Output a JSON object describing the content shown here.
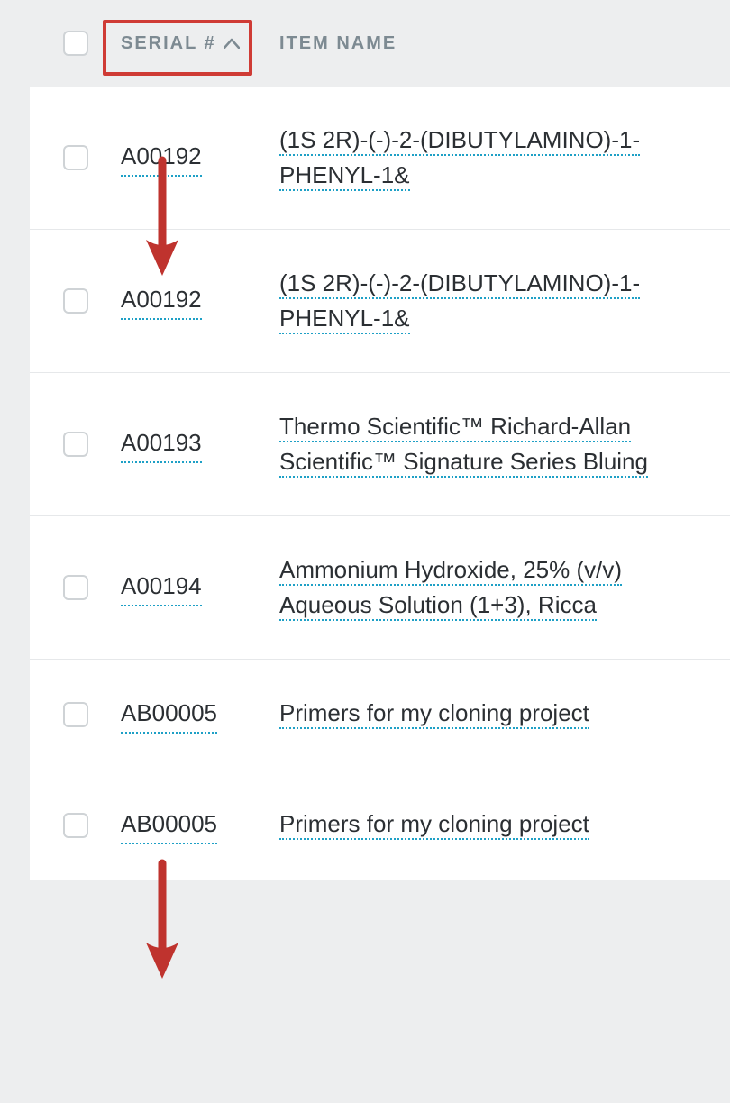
{
  "columns": {
    "serial": "SERIAL #",
    "name": "ITEM NAME"
  },
  "rows": [
    {
      "serial": "A00192",
      "name": "(1S 2R)-(-)-2-(DIBUTYLAMINO)-1-PHENYL-1&"
    },
    {
      "serial": "A00192",
      "name": "(1S 2R)-(-)-2-(DIBUTYLAMINO)-1-PHENYL-1&"
    },
    {
      "serial": "A00193",
      "name": "Thermo Scientific™ Richard-Allan Scientific™ Signature Series Bluing"
    },
    {
      "serial": "A00194",
      "name": "Ammonium Hydroxide, 25% (v/v) Aqueous Solution (1+3), Ricca"
    },
    {
      "serial": "AB00005",
      "name": "Primers for my cloning project"
    },
    {
      "serial": "AB00005",
      "name": "Primers for my cloning project"
    }
  ],
  "annotations": {
    "highlight_color": "#cf3b35"
  }
}
